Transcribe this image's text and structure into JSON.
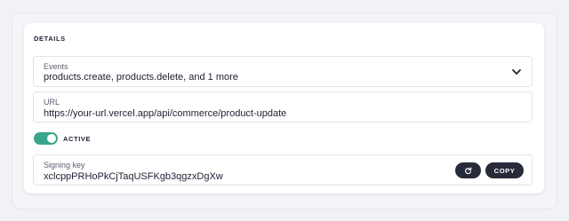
{
  "details": {
    "title": "DETAILS",
    "events": {
      "label": "Events",
      "value": "products.create, products.delete, and 1 more",
      "icon": "chevron-down-icon"
    },
    "url": {
      "label": "URL",
      "value": "https://your-url.vercel.app/api/commerce/product-update"
    },
    "active": {
      "label": "ACTIVE",
      "on": true,
      "color": "#3aa58b"
    },
    "signing_key": {
      "label": "Signing key",
      "value": "xclcppPRHoPkCjTaqUSFKgb3qgzxDgXw",
      "refresh_icon": "refresh-icon",
      "copy_label": "COPY"
    }
  },
  "colors": {
    "button_bg": "#272b39",
    "text": "#1d2130",
    "muted": "#5b6070"
  }
}
